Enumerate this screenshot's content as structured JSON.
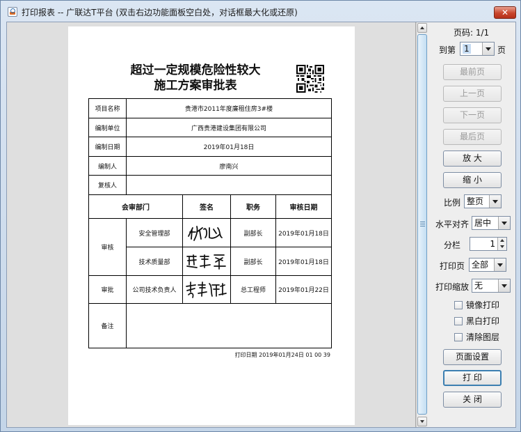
{
  "window": {
    "title": "打印报表 -- 广联达T平台   (双击右边功能面板空白处，对话框最大化或还原)",
    "close_glyph": "✕"
  },
  "document": {
    "title_line1": "超过一定规模危险性较大",
    "title_line2": "施工方案审批表",
    "rows": [
      {
        "label": "项目名称",
        "value": "贵港市2011年度廉租住房3#楼"
      },
      {
        "label": "编制单位",
        "value": "广西贵港建设集团有限公司"
      },
      {
        "label": "编制日期",
        "value": "2019年01月18日"
      },
      {
        "label": "编制人",
        "value": "廖南兴"
      },
      {
        "label": "复核人",
        "value": ""
      }
    ],
    "approval_headers": [
      "会审部门",
      "签名",
      "职务",
      "审核日期"
    ],
    "review_label": "审核",
    "approve_label": "审批",
    "approvals": [
      {
        "dept": "安全管理部",
        "title": "副部长",
        "date": "2019年01月18日"
      },
      {
        "dept": "技术质量部",
        "title": "副部长",
        "date": "2019年01月18日"
      },
      {
        "dept": "公司技术负责人",
        "title": "总工程师",
        "date": "2019年01月22日"
      }
    ],
    "remarks_label": "备注",
    "print_date": "打印日期 2019年01月24日 01 00 39"
  },
  "panel": {
    "page_code_label": "页码:",
    "page_code_value": "1/1",
    "goto_label": "到第",
    "goto_value": "1",
    "page_suffix": "页",
    "buttons": {
      "first": "最前页",
      "prev": "上一页",
      "next": "下一页",
      "last": "最后页",
      "zoom_in": "放   大",
      "zoom_out": "缩   小",
      "page_setup": "页面设置",
      "print": "打   印",
      "close": "关   闭"
    },
    "scale_label": "比例",
    "scale_value": "整页",
    "halign_label": "水平对齐",
    "halign_value": "居中",
    "columns_label": "分栏",
    "columns_value": "1",
    "print_pages_label": "打印页",
    "print_pages_value": "全部",
    "print_scale_label": "打印缩放",
    "print_scale_value": "无",
    "checkboxes": {
      "mirror": "镜像打印",
      "bw": "黑白打印",
      "clear_layer": "清除图层"
    }
  },
  "colors": {
    "disabled_text": "#9a9a9a",
    "focus_border": "#3c7fb1",
    "close_red": "#c9462c"
  }
}
